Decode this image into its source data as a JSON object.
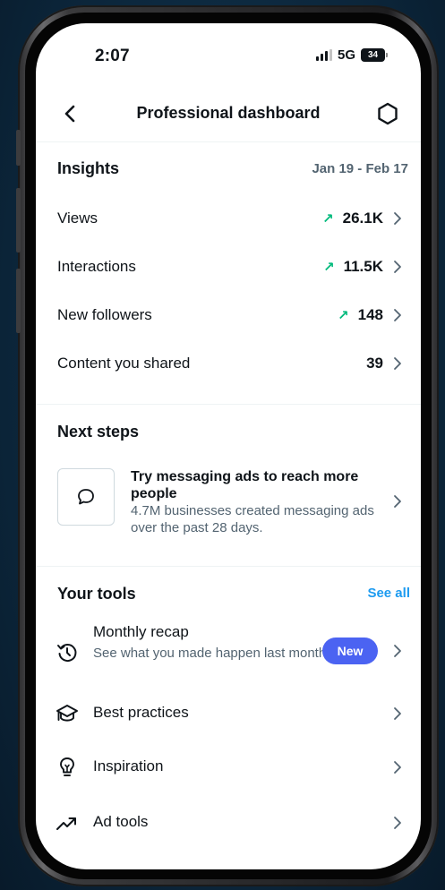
{
  "status": {
    "time": "2:07",
    "network": "5G",
    "battery": "34"
  },
  "nav": {
    "title": "Professional dashboard"
  },
  "insights": {
    "title": "Insights",
    "range": "Jan 19 - Feb 17",
    "metrics": [
      {
        "label": "Views",
        "value": "26.1K",
        "trend": "up"
      },
      {
        "label": "Interactions",
        "value": "11.5K",
        "trend": "up"
      },
      {
        "label": "New followers",
        "value": "148",
        "trend": "up"
      },
      {
        "label": "Content you shared",
        "value": "39",
        "trend": ""
      }
    ]
  },
  "next_steps": {
    "title": "Next steps",
    "card": {
      "title": "Try messaging ads to reach more people",
      "description": "4.7M businesses created messaging ads over the past 28 days.",
      "icon": "message-bubble-icon"
    }
  },
  "tools": {
    "title": "Your tools",
    "see_all": "See all",
    "items": [
      {
        "label": "Monthly recap",
        "subtitle": "See what you made happen last month.",
        "badge": "New",
        "icon": "history-icon"
      },
      {
        "label": "Best practices",
        "icon": "graduation-cap-icon"
      },
      {
        "label": "Inspiration",
        "icon": "lightbulb-icon"
      },
      {
        "label": "Ad tools",
        "icon": "trending-arrow-icon"
      }
    ]
  },
  "colors": {
    "accent": "#1d9bf0",
    "trend": "#00ba7c",
    "badge": "#4b63f2",
    "secondary_text": "#536471"
  }
}
